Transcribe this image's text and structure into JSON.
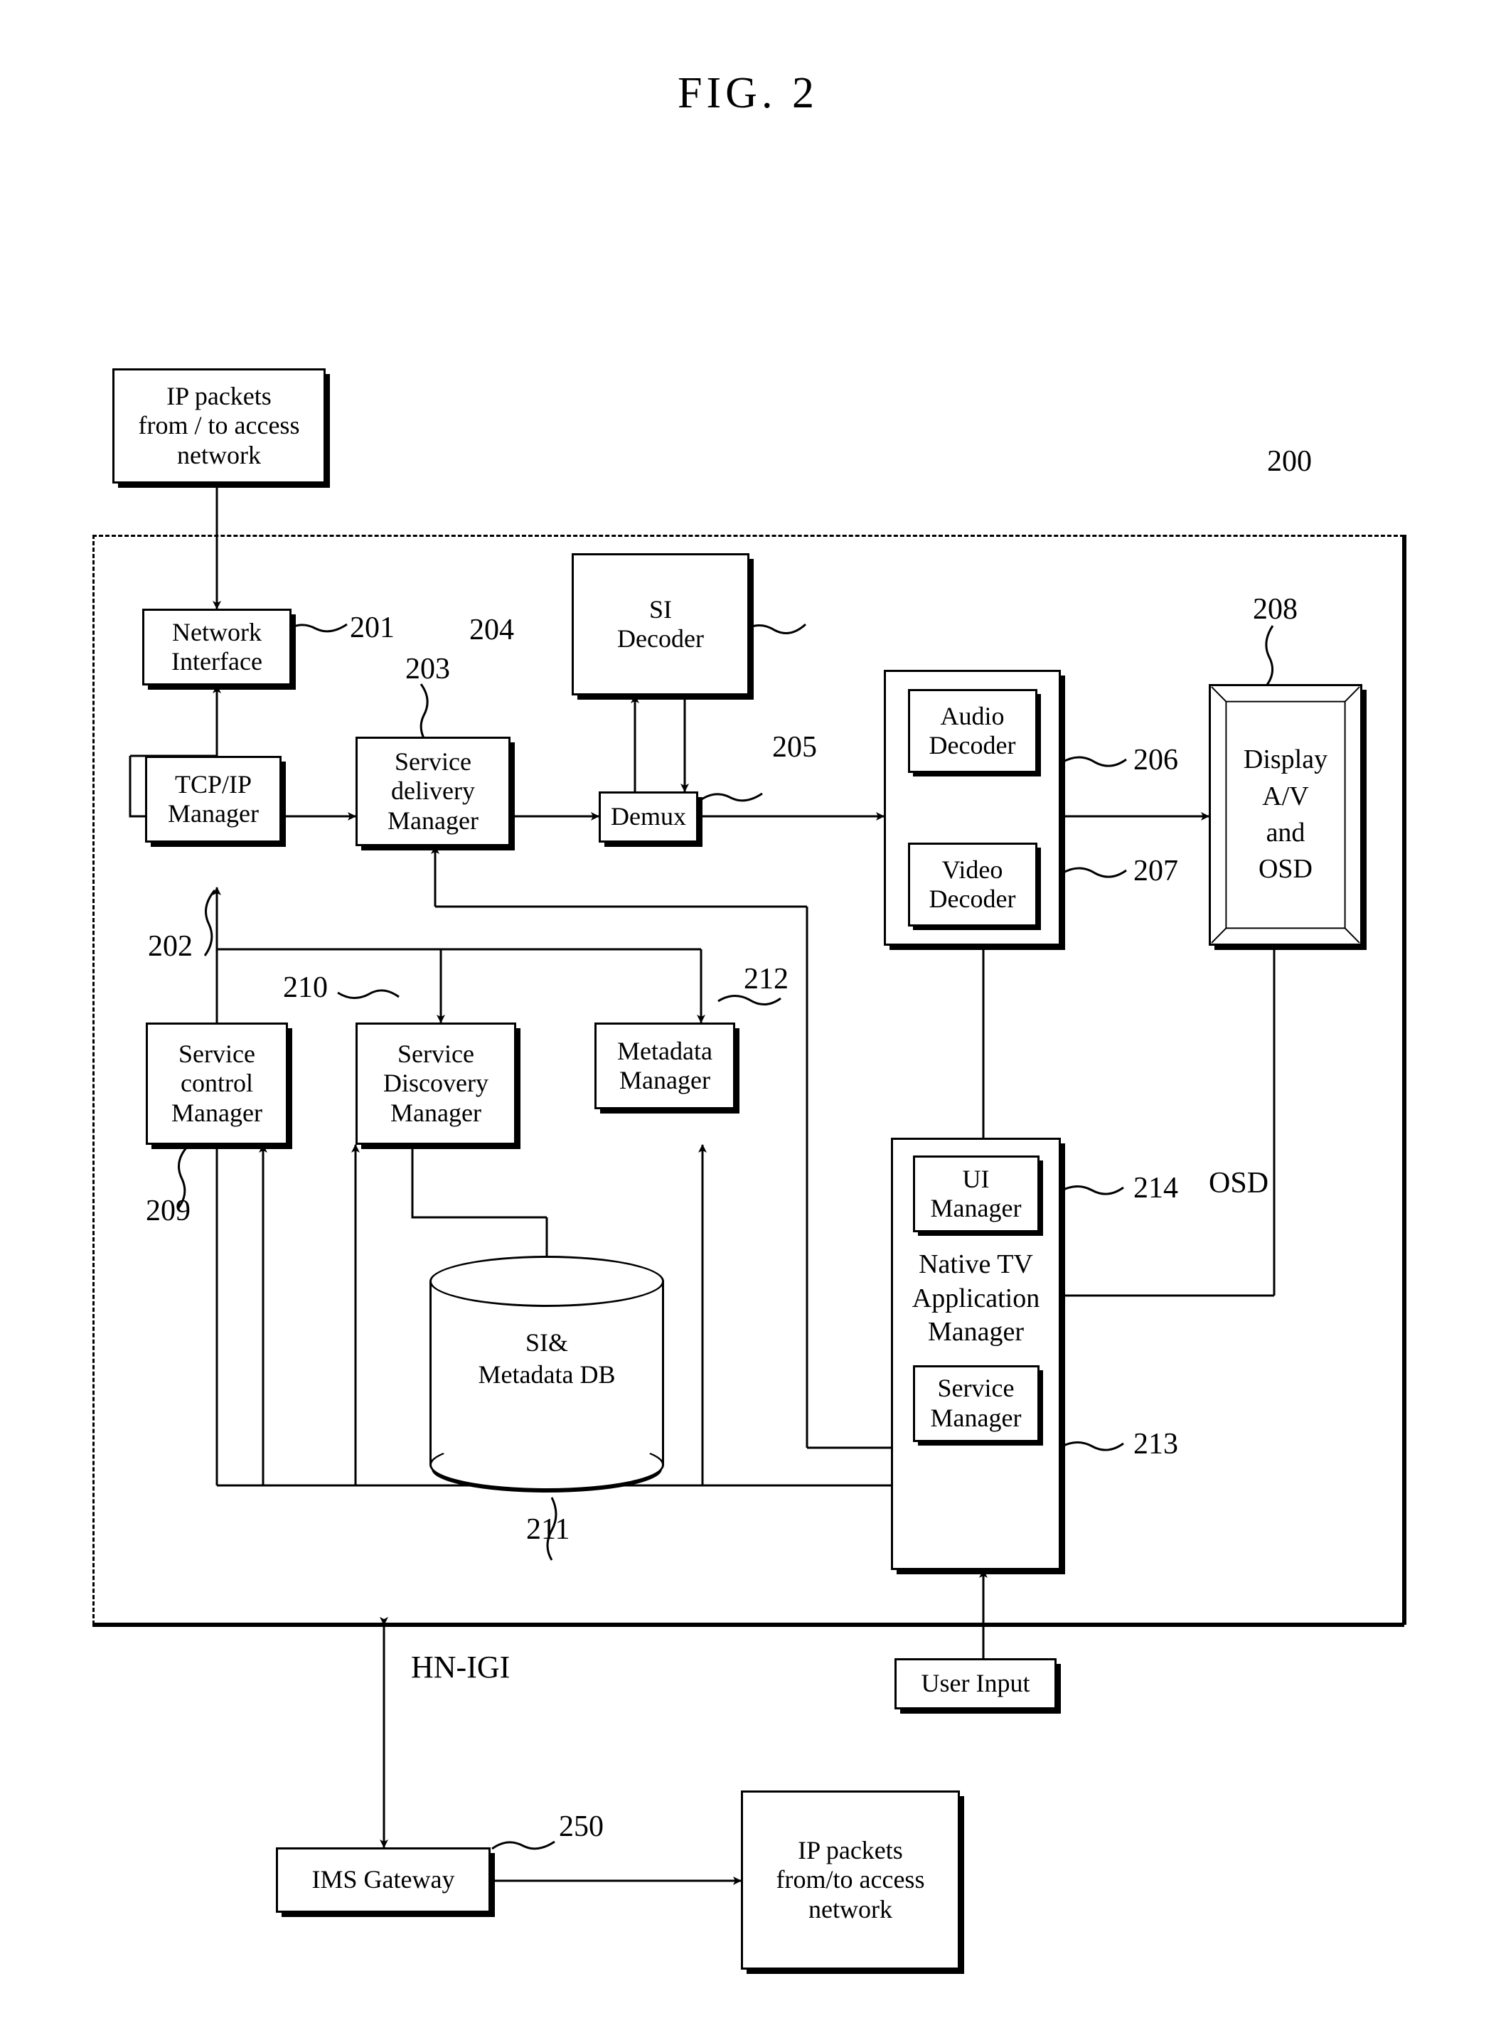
{
  "figure": {
    "title": "FIG. 2"
  },
  "external": {
    "ip_packets_top": "IP packets\nfrom / to access\nnetwork",
    "ip_packets_bottom": "IP packets\nfrom/to access\nnetwork",
    "user_input": "User Input",
    "ims_gateway": "IMS Gateway"
  },
  "labels": {
    "hn_igi": "HN-IGI",
    "osd": "OSD"
  },
  "refs": {
    "device": "200",
    "network_interface": "201",
    "tcpip_manager": "202",
    "service_delivery_manager": "203",
    "si_decoder": "204",
    "demux": "205",
    "audio_decoder": "206",
    "video_decoder": "207",
    "display": "208",
    "service_control_manager": "209",
    "service_discovery_manager": "210",
    "si_metadata_db": "211",
    "metadata_manager": "212",
    "service_manager": "213",
    "ui_manager": "214",
    "ims_gateway": "250"
  },
  "blocks": {
    "network_interface": "Network\nInterface",
    "tcpip_manager": "TCP/IP\nManager",
    "service_delivery_manager": "Service\ndelivery\nManager",
    "si_decoder": "SI\nDecoder",
    "demux": "Demux",
    "audio_decoder": "Audio\nDecoder",
    "video_decoder": "Video\nDecoder",
    "display": "Display\nA/V\nand\nOSD",
    "service_control_manager": "Service\ncontrol\nManager",
    "service_discovery_manager": "Service\nDiscovery\nManager",
    "metadata_manager": "Metadata\nManager",
    "si_metadata_db": "SI&\nMetadata DB",
    "ui_manager": "UI\nManager",
    "native_tv_application_manager": "Native TV\nApplication\nManager",
    "service_manager": "Service\nManager"
  },
  "colors": {
    "ink": "#000000",
    "paper": "#ffffff"
  }
}
